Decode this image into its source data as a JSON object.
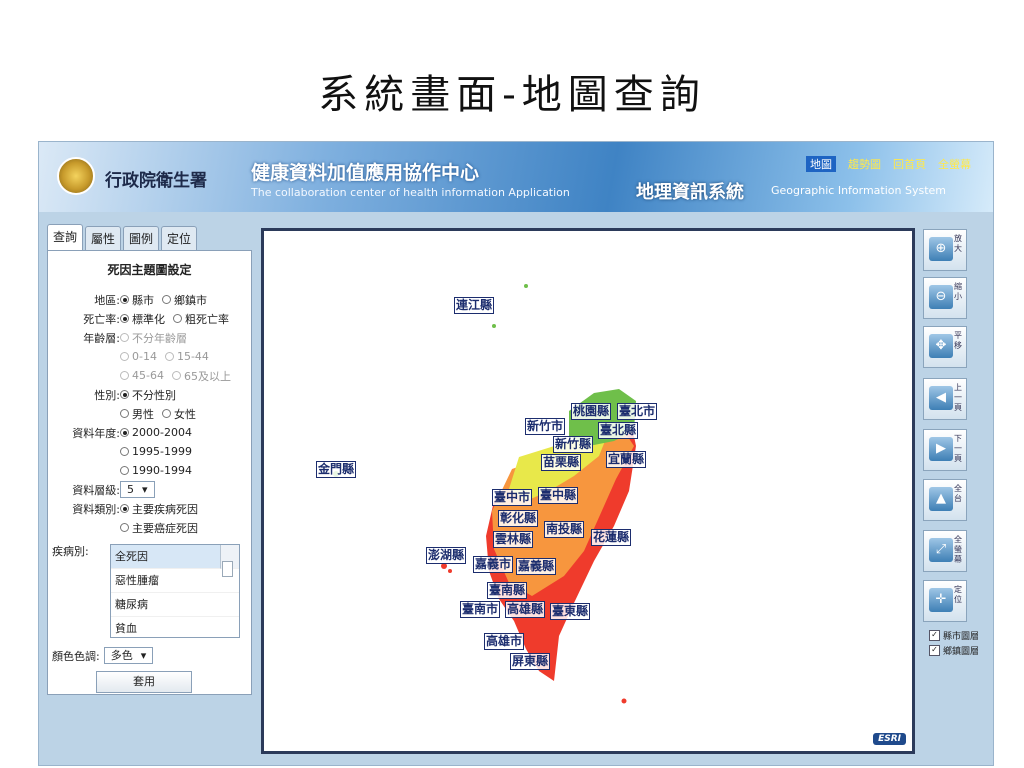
{
  "slide_title": "系統畫面-地圖查詢",
  "header": {
    "logo_text": "行政院衛生署",
    "center_title": "健康資料加值應用協作中心",
    "center_subtitle": "The collaboration center of health information Application",
    "gis_title": "地理資訊系統",
    "gis_subtitle": "Geographic Information System",
    "nav": [
      "地圖",
      "趨勢圖",
      "回首頁",
      "全螢幕"
    ]
  },
  "tabs": [
    "查詢",
    "屬性",
    "圖例",
    "定位"
  ],
  "panel": {
    "title": "死因主題圖設定",
    "region_label": "地區:",
    "region_opt1": "縣市",
    "region_opt2": "鄉鎮市",
    "rate_label": "死亡率:",
    "rate_opt1": "標準化",
    "rate_opt2": "粗死亡率",
    "age_label": "年齡層:",
    "age_all": "不分年齡層",
    "age_1": "0-14",
    "age_2": "15-44",
    "age_3": "45-64",
    "age_4": "65及以上",
    "sex_label": "性別:",
    "sex_all": "不分性別",
    "sex_m": "男性",
    "sex_f": "女性",
    "year_label": "資料年度:",
    "year_1": "2000-2004",
    "year_2": "1995-1999",
    "year_3": "1990-1994",
    "level_label": "資料層級:",
    "level_value": "5",
    "type_label": "資料類別:",
    "type_1": "主要疾病死因",
    "type_2": "主要癌症死因",
    "disease_label": "疾病別:",
    "disease_items": [
      "全死因",
      "惡性腫瘤",
      "糖尿病",
      "貧血"
    ],
    "color_label": "顏色色調:",
    "color_value": "多色",
    "apply_button": "套用"
  },
  "map": {
    "labels": {
      "lianjiang": "連江縣",
      "kinmen": "金門縣",
      "taoyuan": "桃園縣",
      "taipei_city": "臺北市",
      "hsinchu_city": "新竹市",
      "taipei_county": "臺北縣",
      "hsinchu_county": "新竹縣",
      "miaoli": "苗栗縣",
      "yilan": "宜蘭縣",
      "taichung_city": "臺中市",
      "taichung_county": "臺中縣",
      "changhua": "彰化縣",
      "nantou": "南投縣",
      "yunlin": "雲林縣",
      "hualien": "花蓮縣",
      "penghu": "澎湖縣",
      "chiayi_city": "嘉義市",
      "chiayi_county": "嘉義縣",
      "tainan_county": "臺南縣",
      "tainan_city": "臺南市",
      "kaohsiung_county": "高雄縣",
      "taitung": "臺東縣",
      "kaohsiung_city": "高雄市",
      "pingtung": "屏東縣"
    },
    "esri_logo": "ESRI"
  },
  "toolbar": [
    {
      "label": "放大",
      "icon": "⊕"
    },
    {
      "label": "縮小",
      "icon": "⊖"
    },
    {
      "label": "平移",
      "icon": "✥"
    },
    {
      "label": "上一頁",
      "icon": "◀"
    },
    {
      "label": "下一頁",
      "icon": "▶"
    },
    {
      "label": "全台",
      "icon": "▲"
    },
    {
      "label": "全螢幕",
      "icon": "⤢"
    },
    {
      "label": "定位",
      "icon": "✛"
    }
  ],
  "layers": [
    "縣市圖層",
    "鄉鎮圖層"
  ],
  "colors": {
    "red": "#ef3b2c",
    "orange": "#f7963e",
    "yellow": "#e8e84a",
    "green": "#6fbf4a",
    "header_blue": "#3f83c4"
  }
}
